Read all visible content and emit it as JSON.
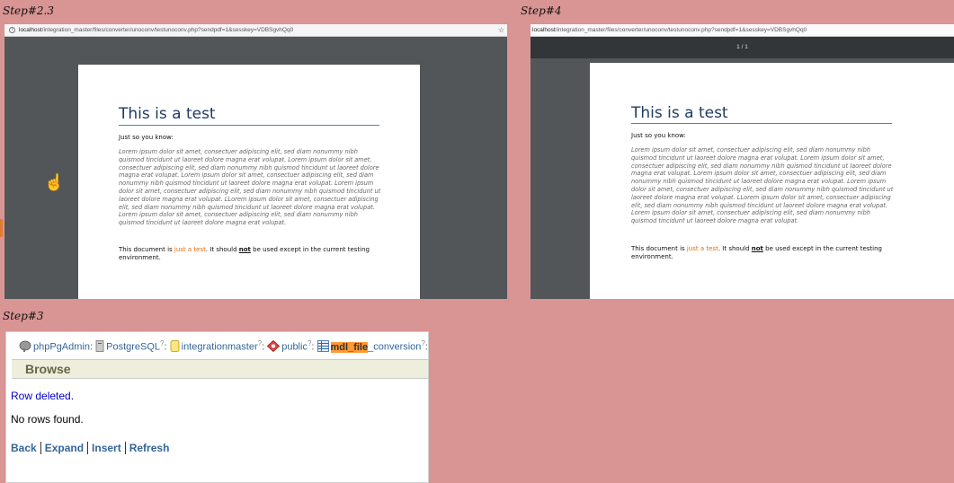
{
  "labels": {
    "step23": "Step#2.3",
    "step4": "Step#4",
    "step3": "Step#3"
  },
  "browser1": {
    "url_host": "localhost",
    "url_path": "/integration_master/files/converter/unoconv/testunoconv.php?sendpdf=1&sesskey=VDBSgvhQq0"
  },
  "browser2": {
    "url_host": "localhost",
    "url_path": "/integration_master/files/converter/unoconv/testunoconv.php?sendpdf=1&sesskey=VDBSgvhQq0",
    "page_indicator": "1 / 1"
  },
  "doc": {
    "title": "This is a test",
    "intro": "Just so you know:",
    "lorem1": "Lorem ipsum dolor sit amet, consectuer adipiscing elit, sed diam nonummy nibh quismod tincidunt ut laoreet dolore magna erat volupat.  Lorem ipsum dolor sit amet, consectuer adipiscing elit, sed diam nonummy nibh quismod tincidunt ut laoreet dolore magna erat volupat.  Lorem ipsum dolor sit amet, consectuer adipiscing elit, sed diam nonummy nibh quismod tincidunt ut laoreet dolore magna erat volupat.  Lorem ipsum dolor sit amet, consectuer adipiscing elit, sed diam nonummy nibh quismod tincidunt ut laoreet dolore magna erat volupat.  LLorem ipsum dolor sit amet, consectuer adipiscing elit, sed diam nonummy nibh quismod tincidunt ut laoreet dolore magna erat volupat.  Lorem ipsum dolor sit amet, consectuer adipiscing elit, sed diam nonummy nibh quismod tincidunt ut laoreet dolore magna erat volupat.",
    "lorem2": "Lorem ipsum dolor sit amet, consectuer adipiscing elit, sed diam nonummy nibh quismod tincidunt ut laoreet dolore magna erat volupat.  Lorem ipsum dolor sit amet, consectuer adipiscing elit, sed diam nonummy nibh quismod tincidunt ut laoreet dolore magna erat volupat.  Lorem ipsum dolor sit amet, consectuer adipiscing elit, sed diam nonummy nibh quismod tincidunt ut laoreet dolore magna erat volupat.  Lorem ipsum dolor sit amet, consectuer adipiscing elit, sed diam nonummy nibh quismod tincidunt ut laoreet dolore magna erat volupat.  LLorem ipsum dolor sit amet, consectuer adipiscing elit, sed diam nonummy nibh quismod tincidunt ut laoreet dolore magna erat volupat.  Lorem ipsum dolor sit amet, consectuer adipiscing elit, sed diam nonummy nibh quismod tincidunt ut laoreet dolore magna erat volupat.",
    "footer_pre": "This document is ",
    "footer_highlight": "just a test",
    "footer_mid": ". It should ",
    "footer_bold": "not",
    "footer_post": " be used except in the current testing environment."
  },
  "pg": {
    "trail": {
      "server": "phpPgAdmin",
      "db_engine": "PostgreSQL",
      "database": "integrationmaster",
      "schema": "public",
      "table_hl": "mdl_file",
      "table_rest": "_conversion",
      "help": "?",
      "colon": ":"
    },
    "section": "Browse",
    "msg_deleted": "Row deleted.",
    "msg_norows": "No rows found.",
    "actions": [
      "Back",
      "Expand",
      "Insert",
      "Refresh"
    ]
  },
  "colors": {
    "background": "#d99494",
    "title_blue": "#1f3b63",
    "accent_orange": "#e36c09",
    "link": "#336699"
  }
}
